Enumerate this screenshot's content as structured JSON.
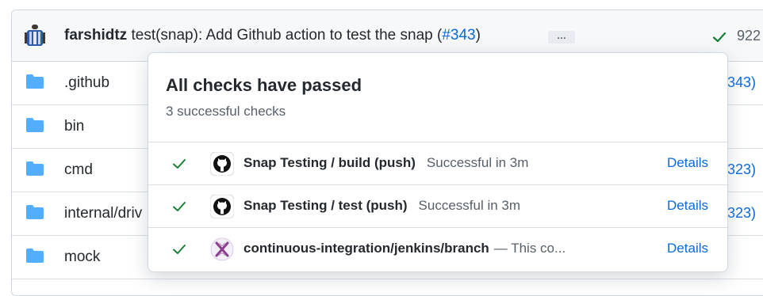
{
  "commit": {
    "author": "farshidtz",
    "message": "test(snap): Add Github action to test the snap (",
    "pr": "#343",
    "pr_close": ")",
    "ellipsis": "…",
    "sha_partial": "922"
  },
  "files": [
    {
      "name": ".github",
      "right_text": "343)"
    },
    {
      "name": "bin",
      "right_text": ""
    },
    {
      "name": "cmd",
      "right_text": "323)"
    },
    {
      "name": "internal/driv",
      "right_text": "323)"
    },
    {
      "name": "mock",
      "right_text": ""
    }
  ],
  "popover": {
    "title": "All checks have passed",
    "subtitle": "3 successful checks",
    "checks": [
      {
        "name": "Snap Testing / build (push)",
        "status": "Successful in 3m",
        "logo": "github-icon",
        "details": "Details"
      },
      {
        "name": "Snap Testing / test (push)",
        "status": "Successful in 3m",
        "logo": "github-icon",
        "details": "Details"
      },
      {
        "name": "continuous-integration/jenkins/branch",
        "status": "— This co...",
        "logo": "jenkins-icon",
        "details": "Details"
      }
    ]
  },
  "colors": {
    "link": "#0969da",
    "success": "#1a7f37",
    "folder": "#54aeff"
  }
}
